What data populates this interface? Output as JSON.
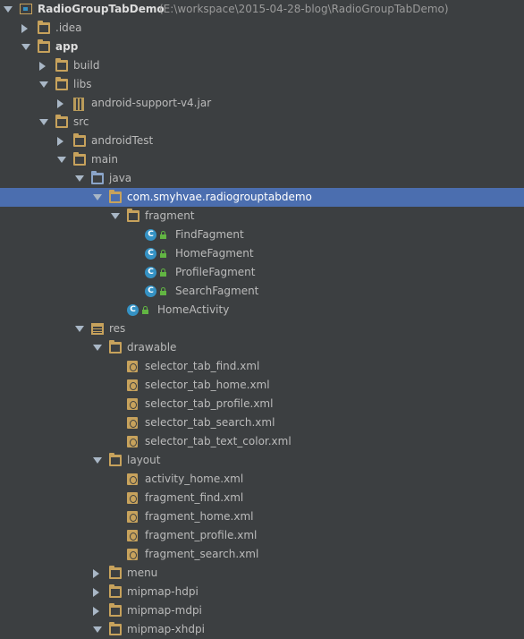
{
  "project": {
    "name": "RadioGroupTabDemo",
    "path": "(E:\\workspace\\2015-04-28-blog\\RadioGroupTabDemo)"
  },
  "tree": [
    {
      "label": ".idea",
      "indent": 1,
      "arrow": "closed",
      "icon": "folder"
    },
    {
      "label": "app",
      "indent": 1,
      "arrow": "open",
      "icon": "module-folder",
      "bold": true
    },
    {
      "label": "build",
      "indent": 2,
      "arrow": "closed",
      "icon": "folder"
    },
    {
      "label": "libs",
      "indent": 2,
      "arrow": "open",
      "icon": "folder"
    },
    {
      "label": "android-support-v4.jar",
      "indent": 3,
      "arrow": "closed",
      "icon": "jar"
    },
    {
      "label": "src",
      "indent": 2,
      "arrow": "open",
      "icon": "folder"
    },
    {
      "label": "androidTest",
      "indent": 3,
      "arrow": "closed",
      "icon": "folder"
    },
    {
      "label": "main",
      "indent": 3,
      "arrow": "open",
      "icon": "folder"
    },
    {
      "label": "java",
      "indent": 4,
      "arrow": "open",
      "icon": "source-folder"
    },
    {
      "label": "com.smyhvae.radiogrouptabdemo",
      "indent": 5,
      "arrow": "open",
      "icon": "package",
      "selected": true
    },
    {
      "label": "fragment",
      "indent": 6,
      "arrow": "open",
      "icon": "package"
    },
    {
      "label": "FindFagment",
      "indent": 7,
      "icon": "class"
    },
    {
      "label": "HomeFagment",
      "indent": 7,
      "icon": "class"
    },
    {
      "label": "ProfileFagment",
      "indent": 7,
      "icon": "class"
    },
    {
      "label": "SearchFagment",
      "indent": 7,
      "icon": "class"
    },
    {
      "label": "HomeActivity",
      "indent": 6,
      "icon": "class"
    },
    {
      "label": "res",
      "indent": 4,
      "arrow": "open",
      "icon": "res-folder"
    },
    {
      "label": "drawable",
      "indent": 5,
      "arrow": "open",
      "icon": "folder"
    },
    {
      "label": "selector_tab_find.xml",
      "indent": 6,
      "icon": "xml"
    },
    {
      "label": "selector_tab_home.xml",
      "indent": 6,
      "icon": "xml"
    },
    {
      "label": "selector_tab_profile.xml",
      "indent": 6,
      "icon": "xml"
    },
    {
      "label": "selector_tab_search.xml",
      "indent": 6,
      "icon": "xml"
    },
    {
      "label": "selector_tab_text_color.xml",
      "indent": 6,
      "icon": "xml"
    },
    {
      "label": "layout",
      "indent": 5,
      "arrow": "open",
      "icon": "folder"
    },
    {
      "label": "activity_home.xml",
      "indent": 6,
      "icon": "xml"
    },
    {
      "label": "fragment_find.xml",
      "indent": 6,
      "icon": "xml"
    },
    {
      "label": "fragment_home.xml",
      "indent": 6,
      "icon": "xml"
    },
    {
      "label": "fragment_profile.xml",
      "indent": 6,
      "icon": "xml"
    },
    {
      "label": "fragment_search.xml",
      "indent": 6,
      "icon": "xml"
    },
    {
      "label": "menu",
      "indent": 5,
      "arrow": "closed",
      "icon": "folder"
    },
    {
      "label": "mipmap-hdpi",
      "indent": 5,
      "arrow": "closed",
      "icon": "folder"
    },
    {
      "label": "mipmap-mdpi",
      "indent": 5,
      "arrow": "closed",
      "icon": "folder"
    },
    {
      "label": "mipmap-xhdpi",
      "indent": 5,
      "arrow": "open",
      "icon": "folder"
    }
  ],
  "colors": {
    "background": "#3c3f41",
    "selection": "#4b6eaf",
    "text": "#bbbbbb",
    "folder": "#c7a25c",
    "class_icon": "#3592c4"
  }
}
